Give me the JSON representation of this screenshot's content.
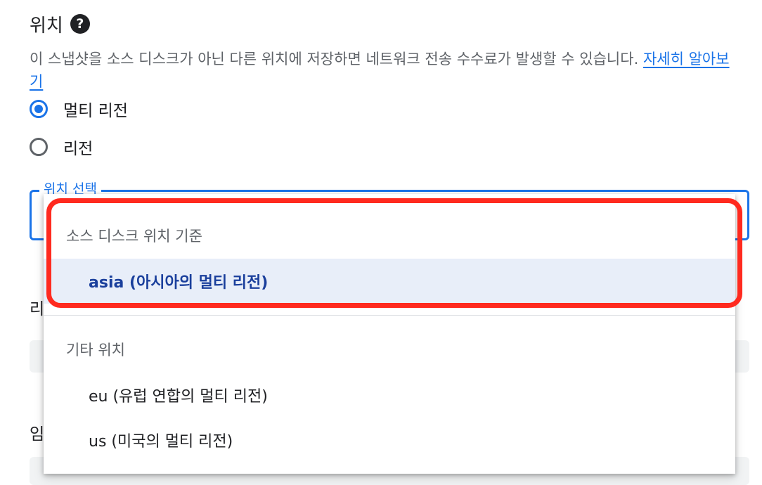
{
  "section": {
    "title": "위치",
    "help_icon": "help-circle-icon",
    "help_glyph": "?",
    "description": "이 스냅샷을 소스 디스크가 아닌 다른 위치에 저장하면 네트워크 전송 수수료가 발생할 수 있습니다. ",
    "learn_more": "자세히 알아보기"
  },
  "location_type": {
    "options": [
      {
        "label": "멀티 리전",
        "checked": true
      },
      {
        "label": "리전",
        "checked": false
      }
    ]
  },
  "select": {
    "label": "위치 선택"
  },
  "background_fields": {
    "label1_partial": "리",
    "label2_partial": "임"
  },
  "dropdown": {
    "groups": [
      {
        "header": "소스 디스크 위치 기준",
        "options": [
          {
            "label": "asia (아시아의 멀티 리전)",
            "selected": true
          }
        ]
      },
      {
        "header": "기타 위치",
        "options": [
          {
            "label": "eu (유럽 연합의 멀티 리전)",
            "selected": false
          },
          {
            "label": "us (미국의 멀티 리전)",
            "selected": false
          }
        ]
      }
    ]
  },
  "colors": {
    "accent": "#1a73e8",
    "selected_bg": "#e8eef9",
    "selected_text": "#1a3f9c",
    "highlight": "#ff2a1f"
  }
}
